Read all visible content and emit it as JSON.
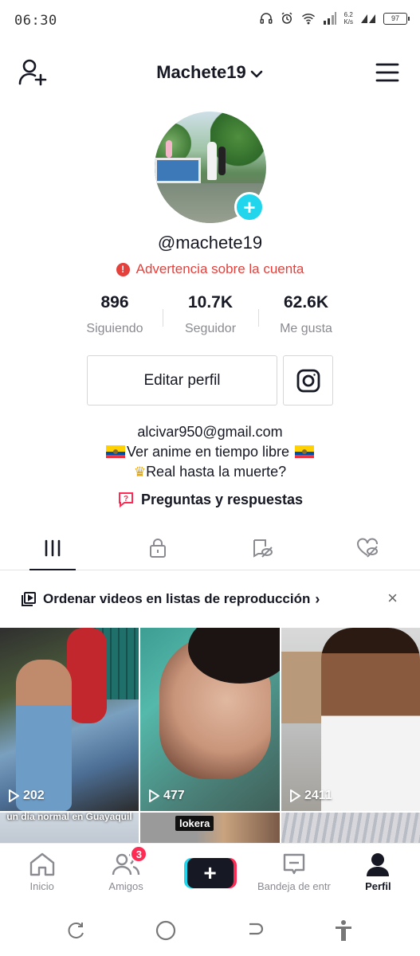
{
  "status_bar": {
    "time": "06:30",
    "net_speed_top": "6.2",
    "net_speed_bottom": "K/s",
    "battery": "97"
  },
  "header": {
    "username": "Machete19"
  },
  "profile": {
    "handle": "@machete19",
    "warning": "Advertencia sobre la cuenta",
    "stats": [
      {
        "value": "896",
        "label": "Siguiendo"
      },
      {
        "value": "10.7K",
        "label": "Seguidor"
      },
      {
        "value": "62.6K",
        "label": "Me gusta"
      }
    ],
    "edit_button": "Editar perfil",
    "bio_email": "alcivar950@gmail.com",
    "bio_line2": "Ver anime en tiempo libre",
    "bio_line3": "Real hasta la muerte?",
    "qa_label": "Preguntas y respuestas"
  },
  "playlist_banner": {
    "text": "Ordenar videos en listas de reproducción",
    "chevron": "›",
    "close": "×"
  },
  "videos": [
    {
      "views": "202"
    },
    {
      "views": "477"
    },
    {
      "views": "2411"
    },
    {
      "caption": "un dia normal en Guayaquil"
    },
    {
      "tag": "lokera"
    },
    {}
  ],
  "bottom_nav": {
    "home": "Inicio",
    "friends": "Amigos",
    "friends_badge": "3",
    "inbox": "Bandeja de entr",
    "profile": "Perfil"
  },
  "colors": {
    "accent_red": "#fe2c55",
    "accent_cyan": "#20d5ec",
    "warning_red": "#e5403b"
  }
}
